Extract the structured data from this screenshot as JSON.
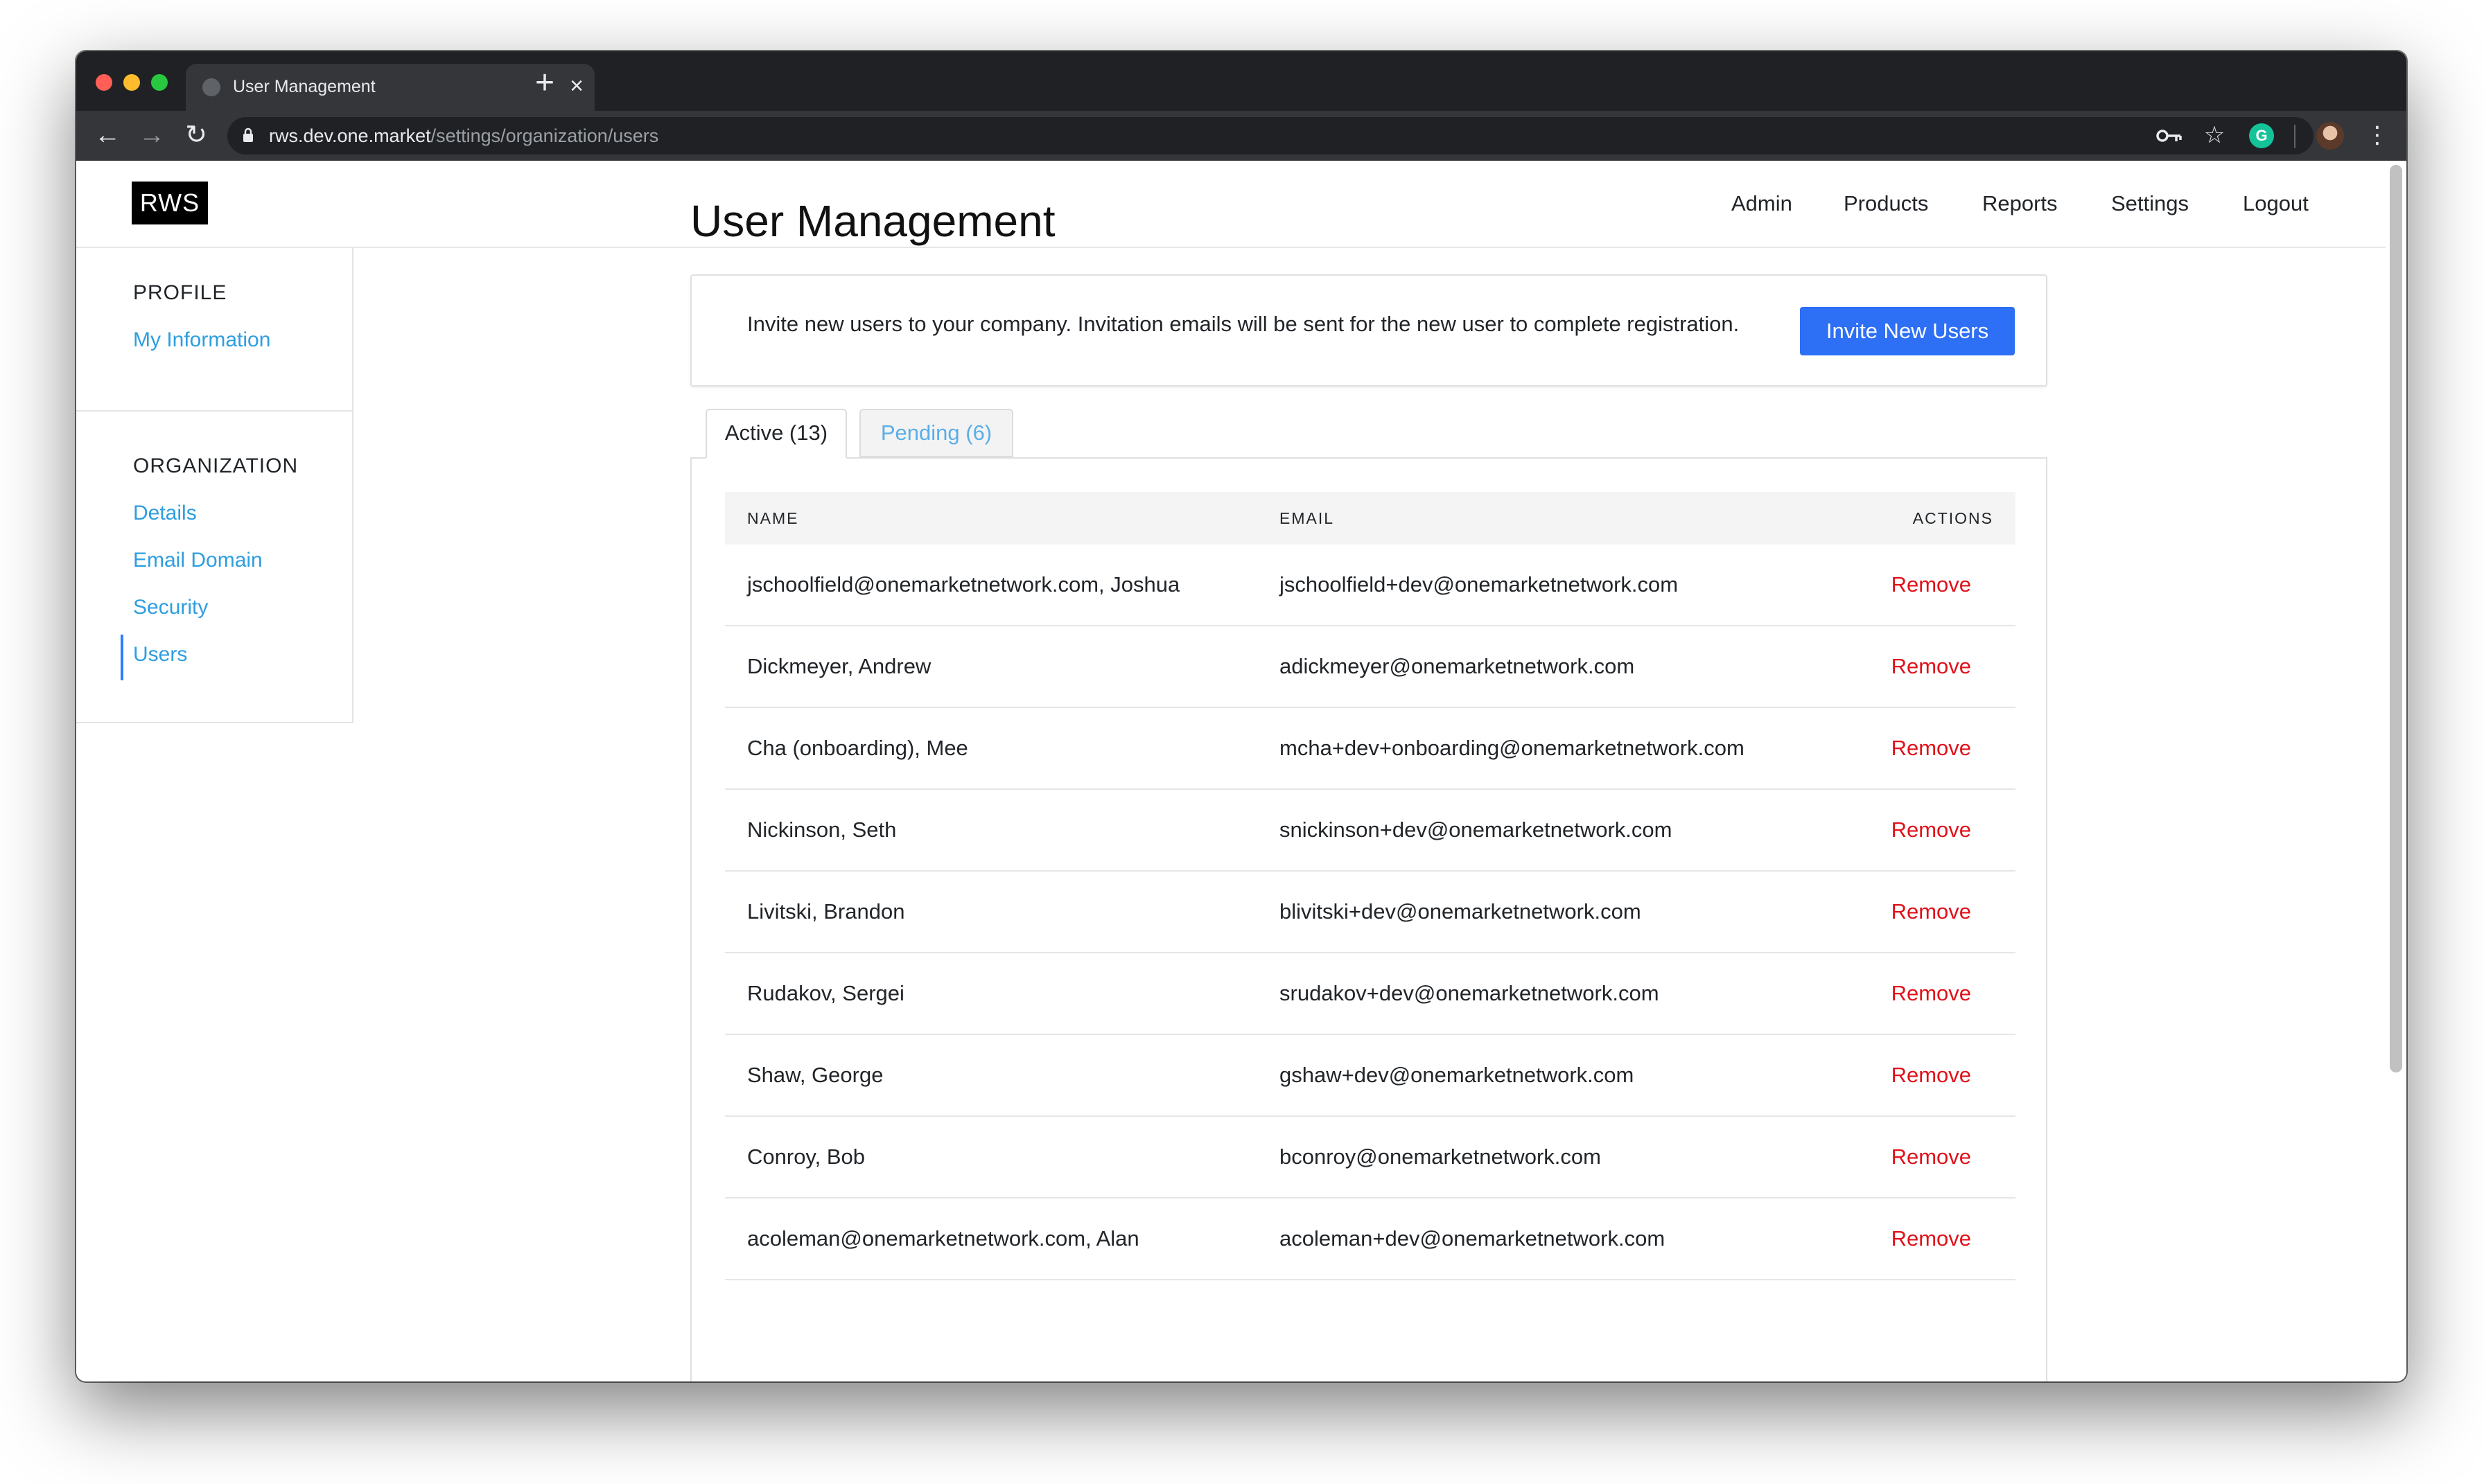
{
  "browser": {
    "tab_title": "User Management",
    "url_host": "rws.dev.one.market",
    "url_path": "/settings/organization/users",
    "new_tab": "+",
    "tab_close": "×"
  },
  "colors": {
    "brand": "#000000",
    "link": "#2d9ee0",
    "primary_button": "#2d6ff5",
    "danger": "#e0111a"
  },
  "header": {
    "logo": "RWS",
    "nav": [
      "Admin",
      "Products",
      "Reports",
      "Settings",
      "Logout"
    ]
  },
  "sidebar": {
    "profile_heading": "PROFILE",
    "profile_links": [
      "My Information"
    ],
    "organization_heading": "ORGANIZATION",
    "organization_links": [
      "Details",
      "Email Domain",
      "Security",
      "Users"
    ],
    "active": "Users"
  },
  "main": {
    "title": "User Management",
    "invite_text": "Invite new users to your company. Invitation emails will be sent for the new user to complete registration.",
    "invite_button": "Invite New Users",
    "tabs": [
      {
        "label": "Active (13)",
        "active": true
      },
      {
        "label": "Pending (6)",
        "active": false
      }
    ],
    "table": {
      "columns": [
        "NAME",
        "EMAIL",
        "ACTIONS"
      ],
      "rows": [
        {
          "name": "jschoolfield@onemarketnetwork.com, Joshua",
          "email": "jschoolfield+dev@onemarketnetwork.com",
          "action": "Remove"
        },
        {
          "name": "Dickmeyer, Andrew",
          "email": "adickmeyer@onemarketnetwork.com",
          "action": "Remove"
        },
        {
          "name": "Cha (onboarding), Mee",
          "email": "mcha+dev+onboarding@onemarketnetwork.com",
          "action": "Remove"
        },
        {
          "name": "Nickinson, Seth",
          "email": "snickinson+dev@onemarketnetwork.com",
          "action": "Remove"
        },
        {
          "name": "Livitski, Brandon",
          "email": "blivitski+dev@onemarketnetwork.com",
          "action": "Remove"
        },
        {
          "name": "Rudakov, Sergei",
          "email": "srudakov+dev@onemarketnetwork.com",
          "action": "Remove"
        },
        {
          "name": "Shaw, George",
          "email": "gshaw+dev@onemarketnetwork.com",
          "action": "Remove"
        },
        {
          "name": "Conroy, Bob",
          "email": "bconroy@onemarketnetwork.com",
          "action": "Remove"
        },
        {
          "name": "acoleman@onemarketnetwork.com, Alan",
          "email": "acoleman+dev@onemarketnetwork.com",
          "action": "Remove"
        }
      ]
    }
  }
}
